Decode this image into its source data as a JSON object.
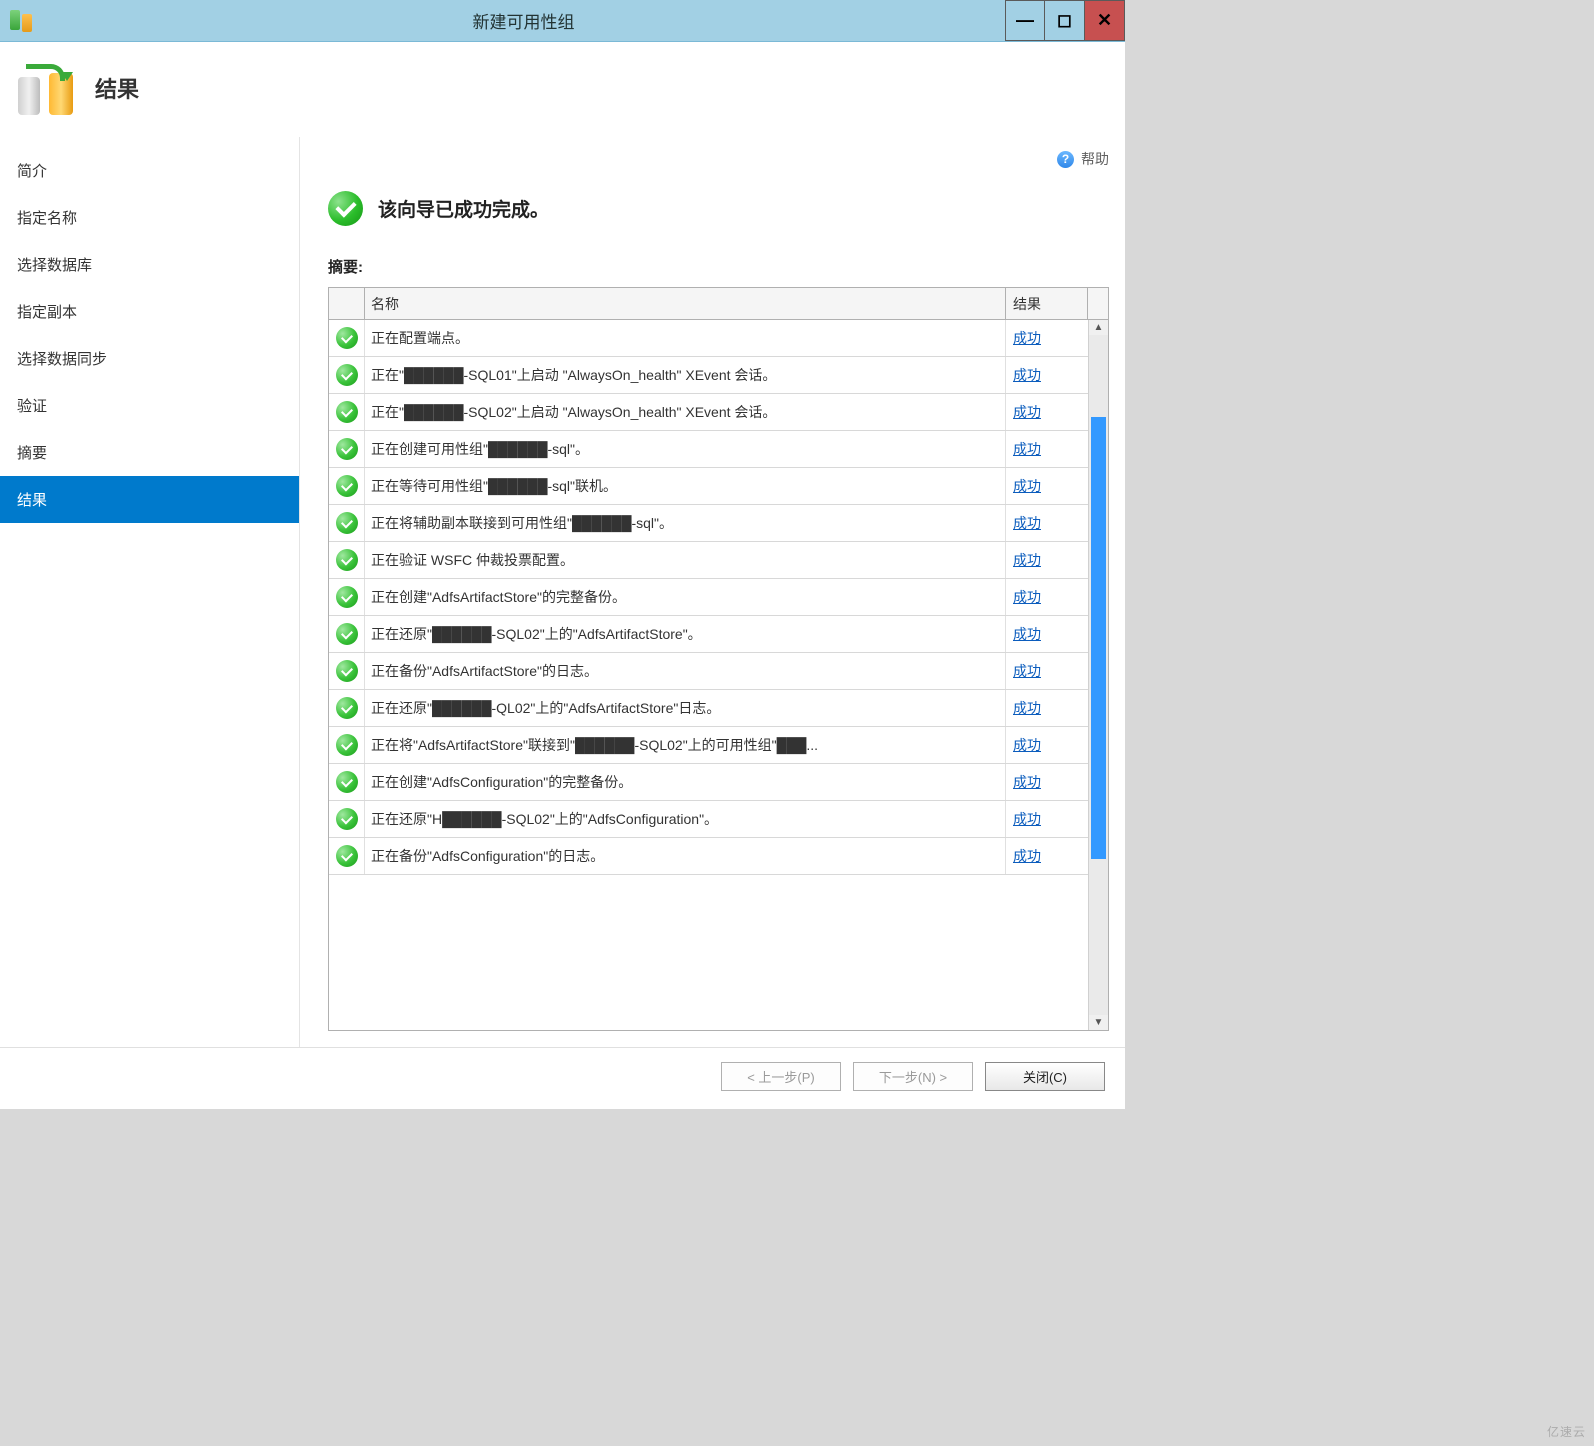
{
  "window": {
    "title": "新建可用性组",
    "btn_min": "—",
    "btn_max": "◻",
    "btn_close": "✕"
  },
  "header": {
    "title": "结果"
  },
  "sidebar": {
    "items": [
      {
        "label": "简介"
      },
      {
        "label": "指定名称"
      },
      {
        "label": "选择数据库"
      },
      {
        "label": "指定副本"
      },
      {
        "label": "选择数据同步"
      },
      {
        "label": "验证"
      },
      {
        "label": "摘要"
      },
      {
        "label": "结果",
        "selected": true
      }
    ]
  },
  "help": {
    "label": "帮助"
  },
  "success": {
    "message": "该向导已成功完成。"
  },
  "summary_label": "摘要:",
  "table": {
    "header": {
      "name": "名称",
      "result": "结果"
    },
    "rows": [
      {
        "name": "正在配置端点。",
        "result": "成功"
      },
      {
        "name": "正在\"██████-SQL01\"上启动 \"AlwaysOn_health\" XEvent 会话。",
        "result": "成功"
      },
      {
        "name": "正在\"██████-SQL02\"上启动 \"AlwaysOn_health\" XEvent 会话。",
        "result": "成功"
      },
      {
        "name": "正在创建可用性组\"██████-sql\"。",
        "result": "成功"
      },
      {
        "name": "正在等待可用性组\"██████-sql\"联机。",
        "result": "成功"
      },
      {
        "name": "正在将辅助副本联接到可用性组\"██████-sql\"。",
        "result": "成功"
      },
      {
        "name": "正在验证 WSFC 仲裁投票配置。",
        "result": "成功"
      },
      {
        "name": "正在创建\"AdfsArtifactStore\"的完整备份。",
        "result": "成功"
      },
      {
        "name": "正在还原\"██████-SQL02\"上的\"AdfsArtifactStore\"。",
        "result": "成功"
      },
      {
        "name": "正在备份\"AdfsArtifactStore\"的日志。",
        "result": "成功"
      },
      {
        "name": "正在还原\"██████-QL02\"上的\"AdfsArtifactStore\"日志。",
        "result": "成功"
      },
      {
        "name": "正在将\"AdfsArtifactStore\"联接到\"██████-SQL02\"上的可用性组\"███...",
        "result": "成功"
      },
      {
        "name": "正在创建\"AdfsConfiguration\"的完整备份。",
        "result": "成功"
      },
      {
        "name": "正在还原\"H██████-SQL02\"上的\"AdfsConfiguration\"。",
        "result": "成功"
      },
      {
        "name": "正在备份\"AdfsConfiguration\"的日志。",
        "result": "成功"
      }
    ]
  },
  "footer": {
    "back": "< 上一步(P)",
    "next": "下一步(N) >",
    "close": "关闭(C)"
  },
  "watermark": "亿速云"
}
